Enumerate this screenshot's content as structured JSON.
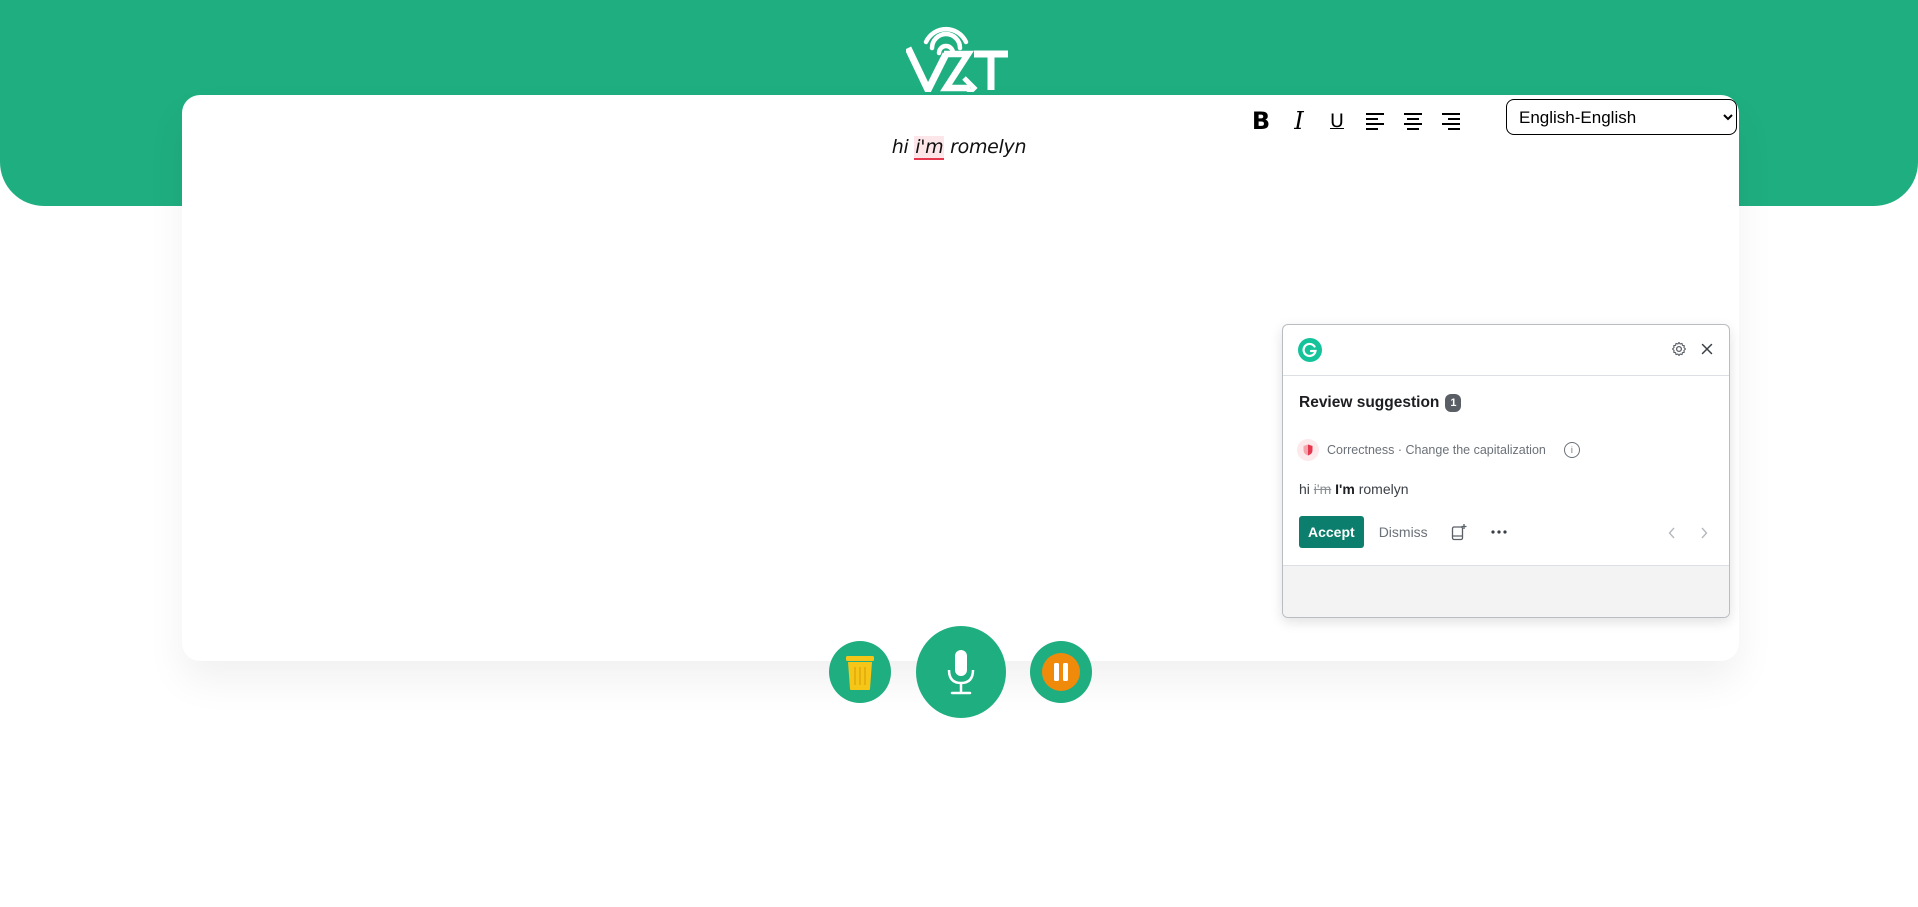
{
  "app": {
    "logo_text": "VZT",
    "brand_color": "#1fae80"
  },
  "toolbar": {
    "bold_label": "B",
    "italic_label": "I",
    "underline_label": "U",
    "align_left_icon": "align-left-icon",
    "align_center_icon": "align-center-icon",
    "align_right_icon": "align-right-icon"
  },
  "language": {
    "selected": "English-English",
    "options": [
      "English-English"
    ]
  },
  "editor": {
    "text_before": "hi ",
    "flagged_word": "i'm",
    "text_after": " romelyn"
  },
  "controls": {
    "delete_icon": "trash-icon",
    "mic_icon": "microphone-icon",
    "pause_icon": "pause-icon",
    "delete_color": "#f5c518",
    "pause_color": "#f08a0b"
  },
  "grammarly": {
    "title": "Review suggestion",
    "count": "1",
    "category": "Correctness · Change the capitalization",
    "preview_before": "hi ",
    "preview_removed": "i'm",
    "preview_inserted": "I'm",
    "preview_after": " romelyn",
    "accept_label": "Accept",
    "dismiss_label": "Dismiss",
    "accent_color": "#0b7e6d"
  }
}
